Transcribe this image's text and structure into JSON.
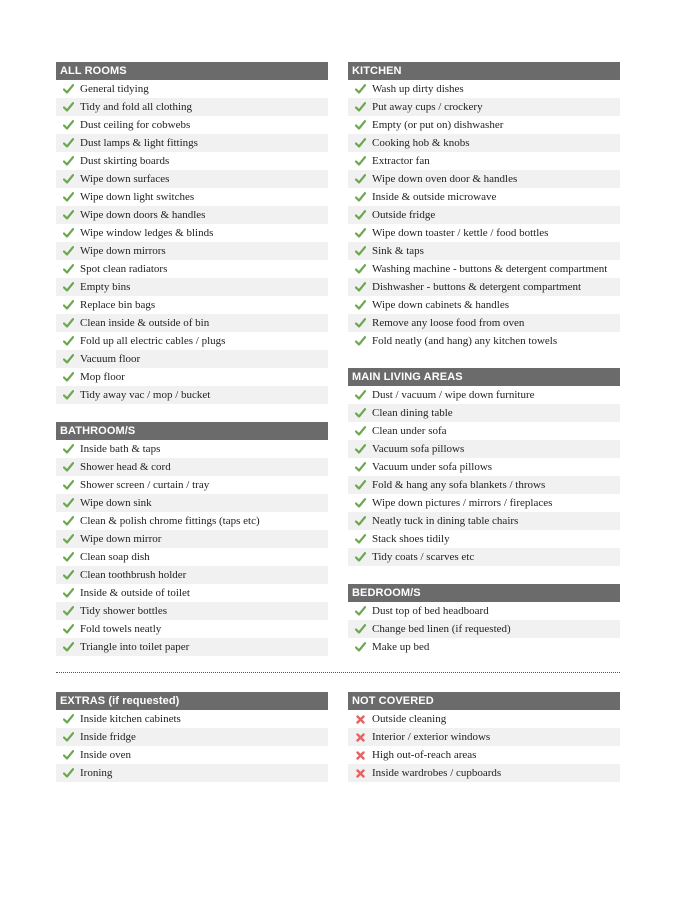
{
  "colors": {
    "header_bg": "#6b6b6b",
    "check": "#6aa84f",
    "cross": "#e06666",
    "alt_row": "#f1f1f1"
  },
  "left_column": [
    {
      "title": "ALL ROOMS",
      "icon": "check",
      "items": [
        "General tidying",
        "Tidy and fold all clothing",
        "Dust ceiling for cobwebs",
        "Dust lamps & light fittings",
        "Dust skirting boards",
        "Wipe down surfaces",
        "Wipe down light switches",
        "Wipe down doors & handles",
        "Wipe window ledges & blinds",
        "Wipe down mirrors",
        "Spot clean radiators",
        "Empty bins",
        "Replace bin bags",
        "Clean inside & outside of bin",
        "Fold up all electric cables / plugs",
        "Vacuum floor",
        "Mop floor",
        "Tidy away vac / mop / bucket"
      ]
    },
    {
      "title": "BATHROOM/S",
      "icon": "check",
      "items": [
        "Inside bath & taps",
        "Shower head & cord",
        "Shower screen / curtain / tray",
        "Wipe down sink",
        "Clean & polish chrome fittings (taps etc)",
        "Wipe down mirror",
        "Clean soap dish",
        "Clean toothbrush holder",
        "Inside & outside of toilet",
        "Tidy shower bottles",
        "Fold towels neatly",
        "Triangle into toilet paper"
      ]
    }
  ],
  "right_column": [
    {
      "title": "KITCHEN",
      "icon": "check",
      "items": [
        "Wash up dirty dishes",
        "Put away cups / crockery",
        "Empty (or put on) dishwasher",
        "Cooking hob & knobs",
        "Extractor fan",
        "Wipe down oven door & handles",
        "Inside & outside microwave",
        "Outside fridge",
        "Wipe down toaster / kettle / food bottles",
        "Sink & taps",
        "Washing machine - buttons & detergent compartment",
        "Dishwasher - buttons & detergent compartment",
        "Wipe down cabinets & handles",
        "Remove any loose food from oven",
        "Fold neatly (and hang) any kitchen towels"
      ]
    },
    {
      "title": "MAIN LIVING AREAS",
      "icon": "check",
      "items": [
        "Dust / vacuum / wipe down furniture",
        "Clean dining table",
        "Clean under sofa",
        "Vacuum sofa pillows",
        "Vacuum under sofa pillows",
        "Fold & hang any sofa blankets / throws",
        "Wipe down pictures / mirrors / fireplaces",
        "Neatly tuck in dining table chairs",
        "Stack shoes tidily",
        "Tidy coats / scarves etc"
      ]
    },
    {
      "title": "BEDROOM/S",
      "icon": "check",
      "items": [
        "Dust top of bed headboard",
        "Change bed linen (if requested)",
        "Make up bed"
      ]
    }
  ],
  "bottom_left": [
    {
      "title": "EXTRAS (if requested)",
      "icon": "check",
      "items": [
        "Inside kitchen cabinets",
        "Inside fridge",
        "Inside oven",
        "Ironing"
      ]
    }
  ],
  "bottom_right": [
    {
      "title": "NOT COVERED",
      "icon": "cross",
      "items": [
        "Outside cleaning",
        "Interior / exterior windows",
        "High out-of-reach areas",
        "Inside wardrobes / cupboards"
      ]
    }
  ]
}
